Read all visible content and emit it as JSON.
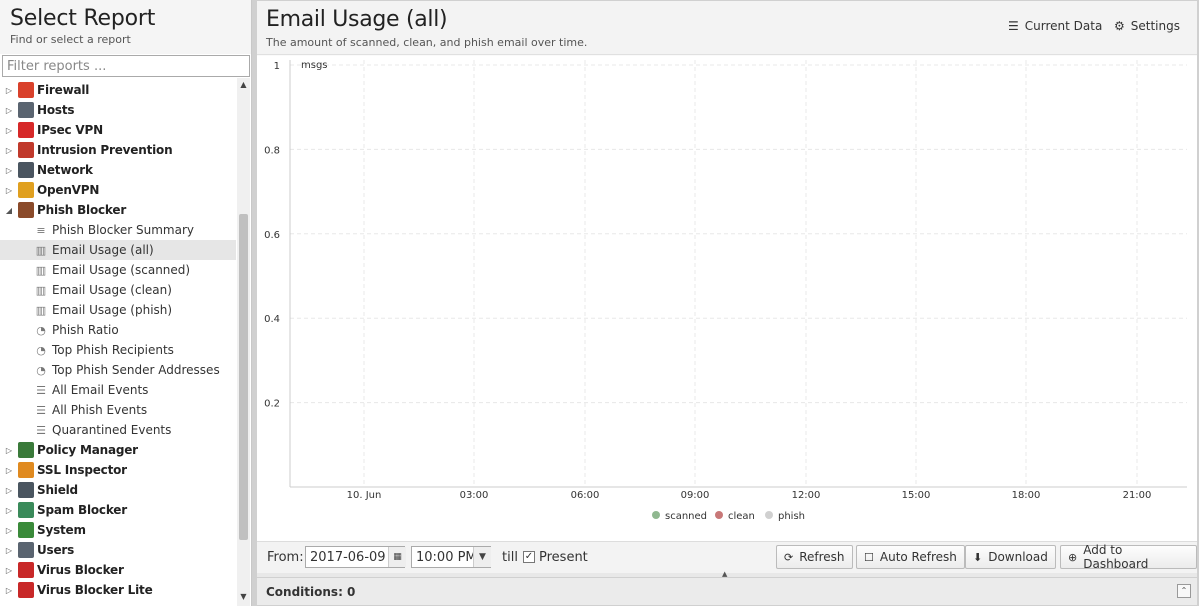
{
  "sidebar": {
    "title": "Select Report",
    "subtitle": "Find or select a report",
    "filter_placeholder": "Filter reports ...",
    "categories": [
      {
        "label": "Firewall",
        "color": "#d9412b",
        "icon": "firewall-icon"
      },
      {
        "label": "Hosts",
        "color": "#5a6470",
        "icon": "hosts-icon"
      },
      {
        "label": "IPsec VPN",
        "color": "#d62828",
        "icon": "lock-icon"
      },
      {
        "label": "Intrusion Prevention",
        "color": "#c0392b",
        "icon": "intrusion-prevention-icon"
      },
      {
        "label": "Network",
        "color": "#4a5560",
        "icon": "network-icon"
      },
      {
        "label": "OpenVPN",
        "color": "#e0a020",
        "icon": "openvpn-icon"
      },
      {
        "label": "Phish Blocker",
        "color": "#8a4a2a",
        "icon": "phish-blocker-icon"
      }
    ],
    "phish_children": [
      {
        "label": "Phish Blocker Summary",
        "icon": "text-report-icon"
      },
      {
        "label": "Email Usage (all)",
        "icon": "bar-chart-icon"
      },
      {
        "label": "Email Usage (scanned)",
        "icon": "bar-chart-icon"
      },
      {
        "label": "Email Usage (clean)",
        "icon": "bar-chart-icon"
      },
      {
        "label": "Email Usage (phish)",
        "icon": "bar-chart-icon"
      },
      {
        "label": "Phish Ratio",
        "icon": "pie-chart-icon"
      },
      {
        "label": "Top Phish Recipients",
        "icon": "pie-chart-icon"
      },
      {
        "label": "Top Phish Sender Addresses",
        "icon": "pie-chart-icon"
      },
      {
        "label": "All Email Events",
        "icon": "list-icon"
      },
      {
        "label": "All Phish Events",
        "icon": "list-icon"
      },
      {
        "label": "Quarantined Events",
        "icon": "list-icon"
      }
    ],
    "categories_after": [
      {
        "label": "Policy Manager",
        "color": "#3a7a3a",
        "icon": "policy-manager-icon"
      },
      {
        "label": "SSL Inspector",
        "color": "#e08a20",
        "icon": "ssl-inspector-icon"
      },
      {
        "label": "Shield",
        "color": "#4a5560",
        "icon": "shield-icon"
      },
      {
        "label": "Spam Blocker",
        "color": "#3a8a5a",
        "icon": "spam-blocker-icon"
      },
      {
        "label": "System",
        "color": "#3a8a3a",
        "icon": "system-icon"
      },
      {
        "label": "Users",
        "color": "#5a6470",
        "icon": "users-icon"
      },
      {
        "label": "Virus Blocker",
        "color": "#c82828",
        "icon": "virus-blocker-icon"
      },
      {
        "label": "Virus Blocker Lite",
        "color": "#c82828",
        "icon": "virus-blocker-lite-icon"
      }
    ]
  },
  "main": {
    "title": "Email Usage (all)",
    "subtitle": "The amount of scanned, clean, and phish email over time.",
    "current_data_label": "Current Data",
    "settings_label": "Settings"
  },
  "chart_data": {
    "type": "line",
    "ylabel": "msgs",
    "ylim": [
      0,
      1
    ],
    "yticks": [
      "1",
      "0.8",
      "0.6",
      "0.4",
      "0.2"
    ],
    "x_ticks": [
      "10. Jun",
      "03:00",
      "06:00",
      "09:00",
      "12:00",
      "15:00",
      "18:00",
      "21:00"
    ],
    "series": [
      {
        "name": "scanned",
        "color": "#90b890",
        "values": []
      },
      {
        "name": "clean",
        "color": "#c87878",
        "values": []
      },
      {
        "name": "phish",
        "color": "#d0d0d0",
        "values": []
      }
    ],
    "grid": true,
    "legend": "bottom"
  },
  "toolbar": {
    "from_label": "From:",
    "from_date": "2017-06-09",
    "from_time": "10:00 PM",
    "till_label": "till",
    "present_label": "Present",
    "present_checked": "✓",
    "refresh_label": "Refresh",
    "auto_refresh_label": "Auto Refresh",
    "download_label": "Download",
    "add_dashboard_label": "Add to Dashboard"
  },
  "conditions": {
    "label": "Conditions: 0"
  }
}
